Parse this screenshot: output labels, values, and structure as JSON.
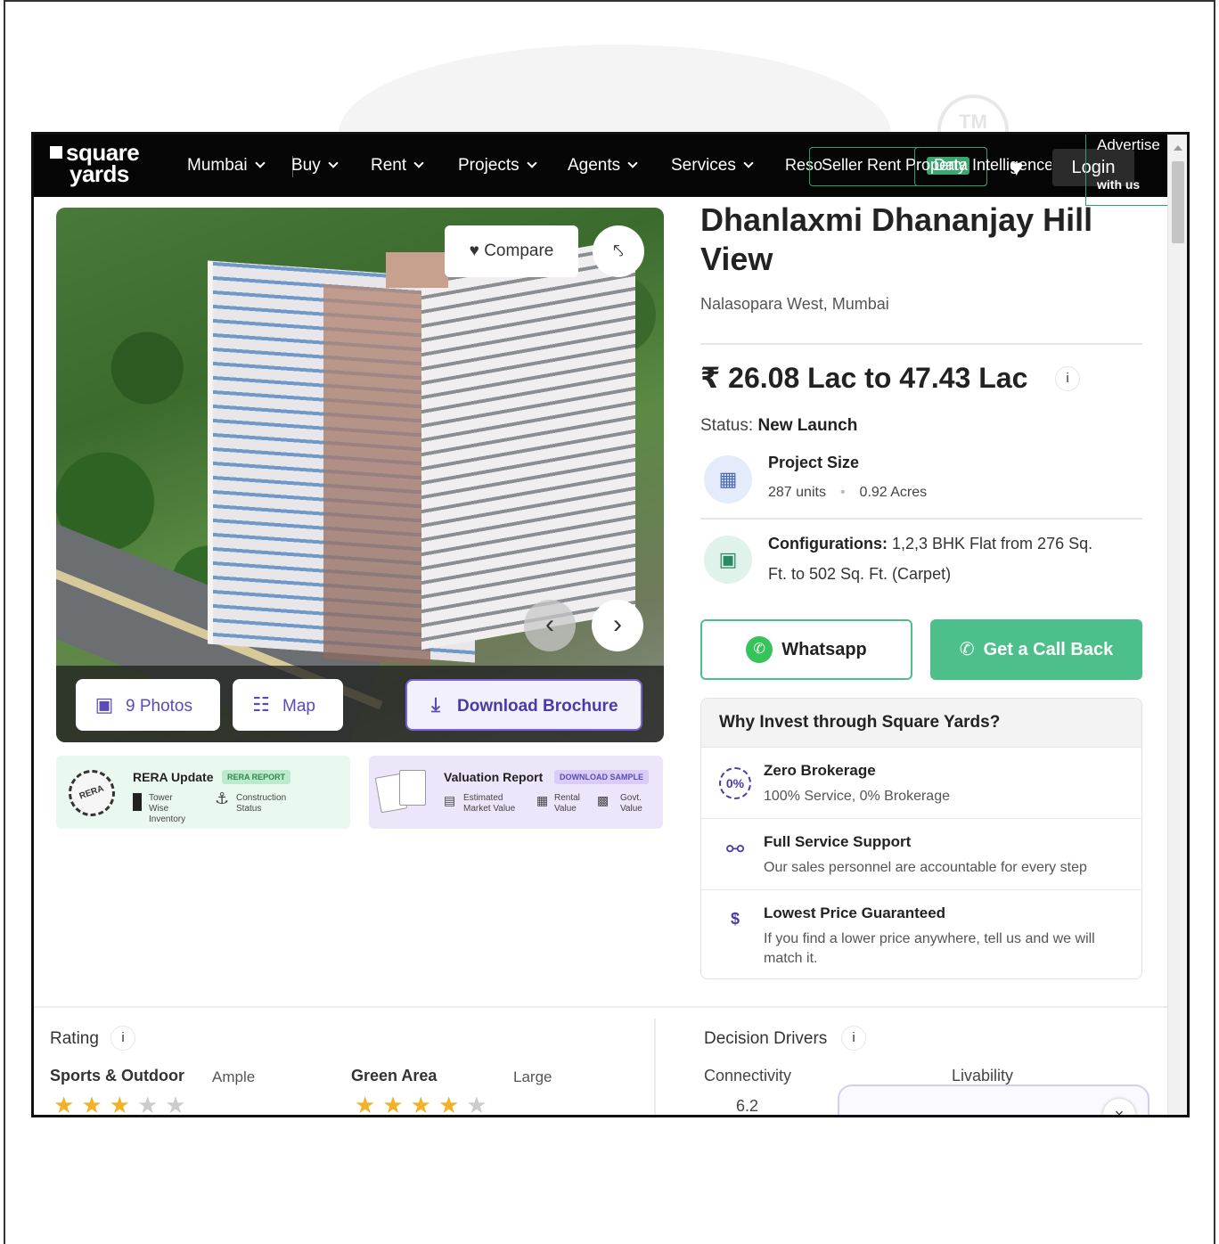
{
  "nav": {
    "logo_line1": "square",
    "logo_line2": "yards",
    "items": [
      {
        "label": "Mumbai"
      },
      {
        "label": "Buy"
      },
      {
        "label": "Rent"
      },
      {
        "label": "Projects"
      },
      {
        "label": "Agents"
      },
      {
        "label": "Services"
      }
    ],
    "overlap_left": "Reso",
    "seller_label": "Seller Rent Property",
    "overlap_right": "Data Intelligence",
    "login_label": "Login",
    "advertise_line1": "Advertise",
    "advertise_line2": "with us"
  },
  "gallery": {
    "compare_label": "Compare",
    "photos_label": "9 Photos",
    "map_label": "Map",
    "brochure_label": "Download Brochure"
  },
  "rera": {
    "title": "RERA Update",
    "tag": "RERA REPORT",
    "seal_text": "RERA",
    "item1": "Tower Wise Inventory",
    "item2": "Construction Status"
  },
  "valuation": {
    "title": "Valuation Report",
    "tag": "DOWNLOAD SAMPLE",
    "item1": "Estimated Market Value",
    "item2": "Rental Value",
    "item3": "Govt. Value"
  },
  "project": {
    "title": "Dhanlaxmi Dhananjay Hill View",
    "location": "Nalasopara West, Mumbai",
    "price": "₹ 26.08 Lac to 47.43 Lac",
    "status_label": "Status:",
    "status_value": "New Launch",
    "size_label": "Project Size",
    "size_units": "287 units",
    "size_acres": "0.92 Acres",
    "config_label": "Configurations:",
    "config_value": "1,2,3 BHK Flat from 276 Sq. Ft. to 502 Sq. Ft. (Carpet)",
    "info_icon": "i"
  },
  "actions": {
    "whatsapp_label": "Whatsapp",
    "callback_label": "Get a Call Back"
  },
  "why": {
    "heading": "Why Invest through Square Yards?",
    "items": [
      {
        "title": "Zero Brokerage",
        "desc": "100% Service, 0% Brokerage"
      },
      {
        "title": "Full Service Support",
        "desc": "Our sales personnel are accountable for every step"
      },
      {
        "title": "Lowest Price Guaranteed",
        "desc": "If you find a lower price anywhere, tell us and we will match it."
      }
    ]
  },
  "rating": {
    "heading": "Rating",
    "items": [
      {
        "label": "Sports & Outdoor",
        "value": "Ample",
        "stars": 3,
        "max": 5
      },
      {
        "label": "Green Area",
        "value": "Large",
        "stars": 4,
        "max": 5
      }
    ]
  },
  "decision": {
    "heading": "Decision Drivers",
    "connectivity_label": "Connectivity",
    "connectivity_value": "6.2",
    "livability_label": "Livability"
  },
  "colors": {
    "accent_green": "#4cbf8a",
    "accent_purple": "#5a4bb5",
    "star": "#f3b226"
  }
}
